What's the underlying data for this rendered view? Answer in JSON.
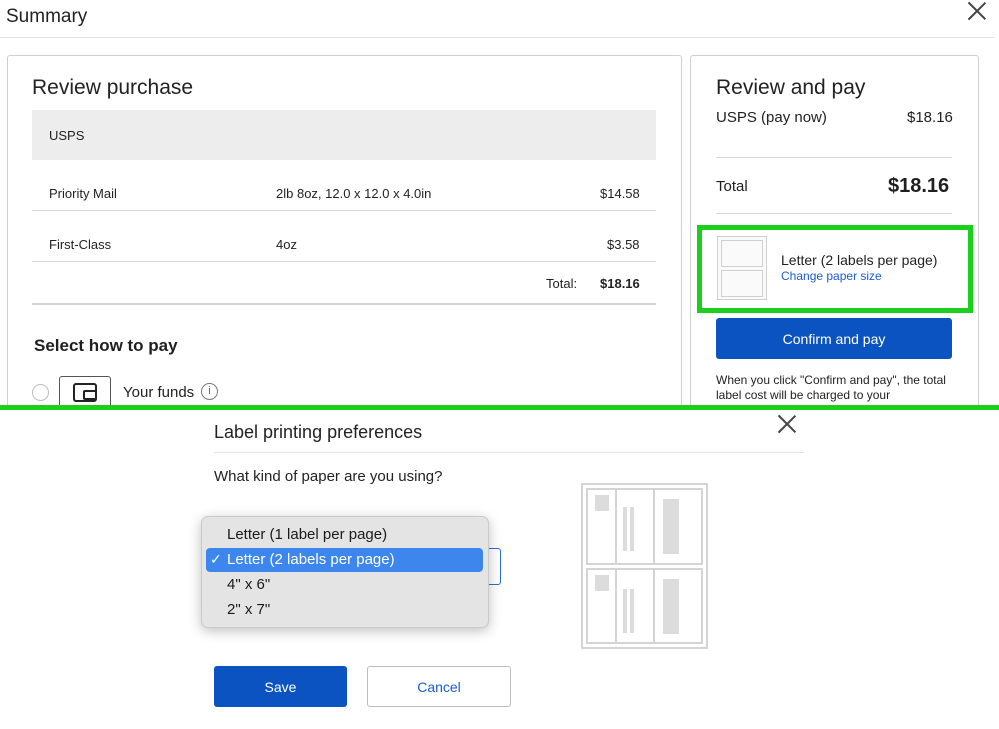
{
  "header": {
    "title": "Summary"
  },
  "review_purchase": {
    "title": "Review purchase",
    "carrier": "USPS",
    "rows": [
      {
        "service": "Priority Mail",
        "details": "2lb 8oz, 12.0 x 12.0 x 4.0in",
        "price": "$14.58"
      },
      {
        "service": "First-Class",
        "details": "4oz",
        "price": "$3.58"
      }
    ],
    "total_label": "Total:",
    "total_value": "$18.16"
  },
  "payment": {
    "heading": "Select how to pay",
    "funds_label": "Your funds",
    "info_glyph": "i"
  },
  "review_pay": {
    "title": "Review and pay",
    "usps_label": "USPS (pay now)",
    "usps_value": "$18.16",
    "total_label": "Total",
    "total_value": "$18.16",
    "paper_label": "Letter (2 labels per page)",
    "change_link": "Change paper size",
    "confirm_button": "Confirm and pay",
    "disclaimer": "When you click \"Confirm and pay\", the total label cost will be charged to your"
  },
  "dialog": {
    "title": "Label printing preferences",
    "question": "What kind of paper are you using?",
    "options": [
      "Letter (1 label per page)",
      "Letter (2 labels per page)",
      "4\" x 6\"",
      "2\" x 7\""
    ],
    "selected_index": 1,
    "check_glyph": "✓",
    "save_button": "Save",
    "cancel_button": "Cancel"
  },
  "colors": {
    "primary": "#0b53c0",
    "link": "#1a5bd3",
    "highlight": "#1ccf1c",
    "selected_option": "#3d86ee"
  }
}
